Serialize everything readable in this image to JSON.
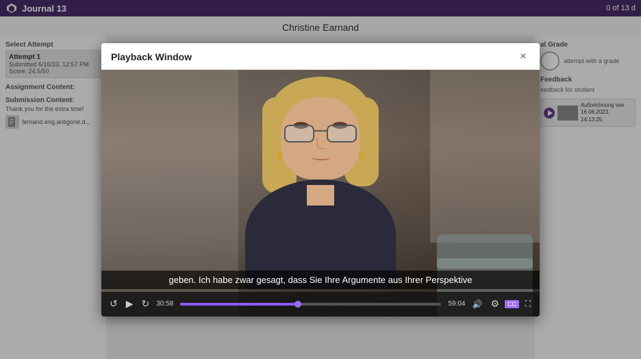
{
  "topbar": {
    "title": "Journal 13",
    "page_indicator": "0 of 13 d"
  },
  "page": {
    "student_name": "Christine Earnand"
  },
  "left_panel": {
    "select_attempt_label": "Select Attempt",
    "attempt": {
      "name": "Attempt 1",
      "submitted": "Submitted 6/16/23, 12:57 PM",
      "score": "Score: 24.5/50"
    },
    "assignment_content_label": "Assignment Content:",
    "submission_content_label": "Submission Content:",
    "submission_note": "Thank you for the extra time!",
    "attachment_name": "fernand.eng.antigone.d..."
  },
  "right_panel": {
    "grade_label": "al Grade",
    "grade_note": "attempt with a grade",
    "feedback_label": "Feedback",
    "feedback_for_student_label": "eedback for student",
    "video_entry": {
      "title": "Aufzeichnung von 16.06.2023,",
      "timestamp": "14:13:25"
    }
  },
  "playback_window": {
    "title": "Playback Window",
    "close_label": "×",
    "subtitle": "geben. Ich habe zwar gesagt, dass Sie Ihre Argumente aus Ihrer Perspektive",
    "time_current": "30:58",
    "time_total": "59:04",
    "controls": {
      "play": "▶",
      "rewind": "↺",
      "forward": "↻",
      "volume": "🔊",
      "fullscreen": "⛶",
      "caption": "CC"
    }
  }
}
